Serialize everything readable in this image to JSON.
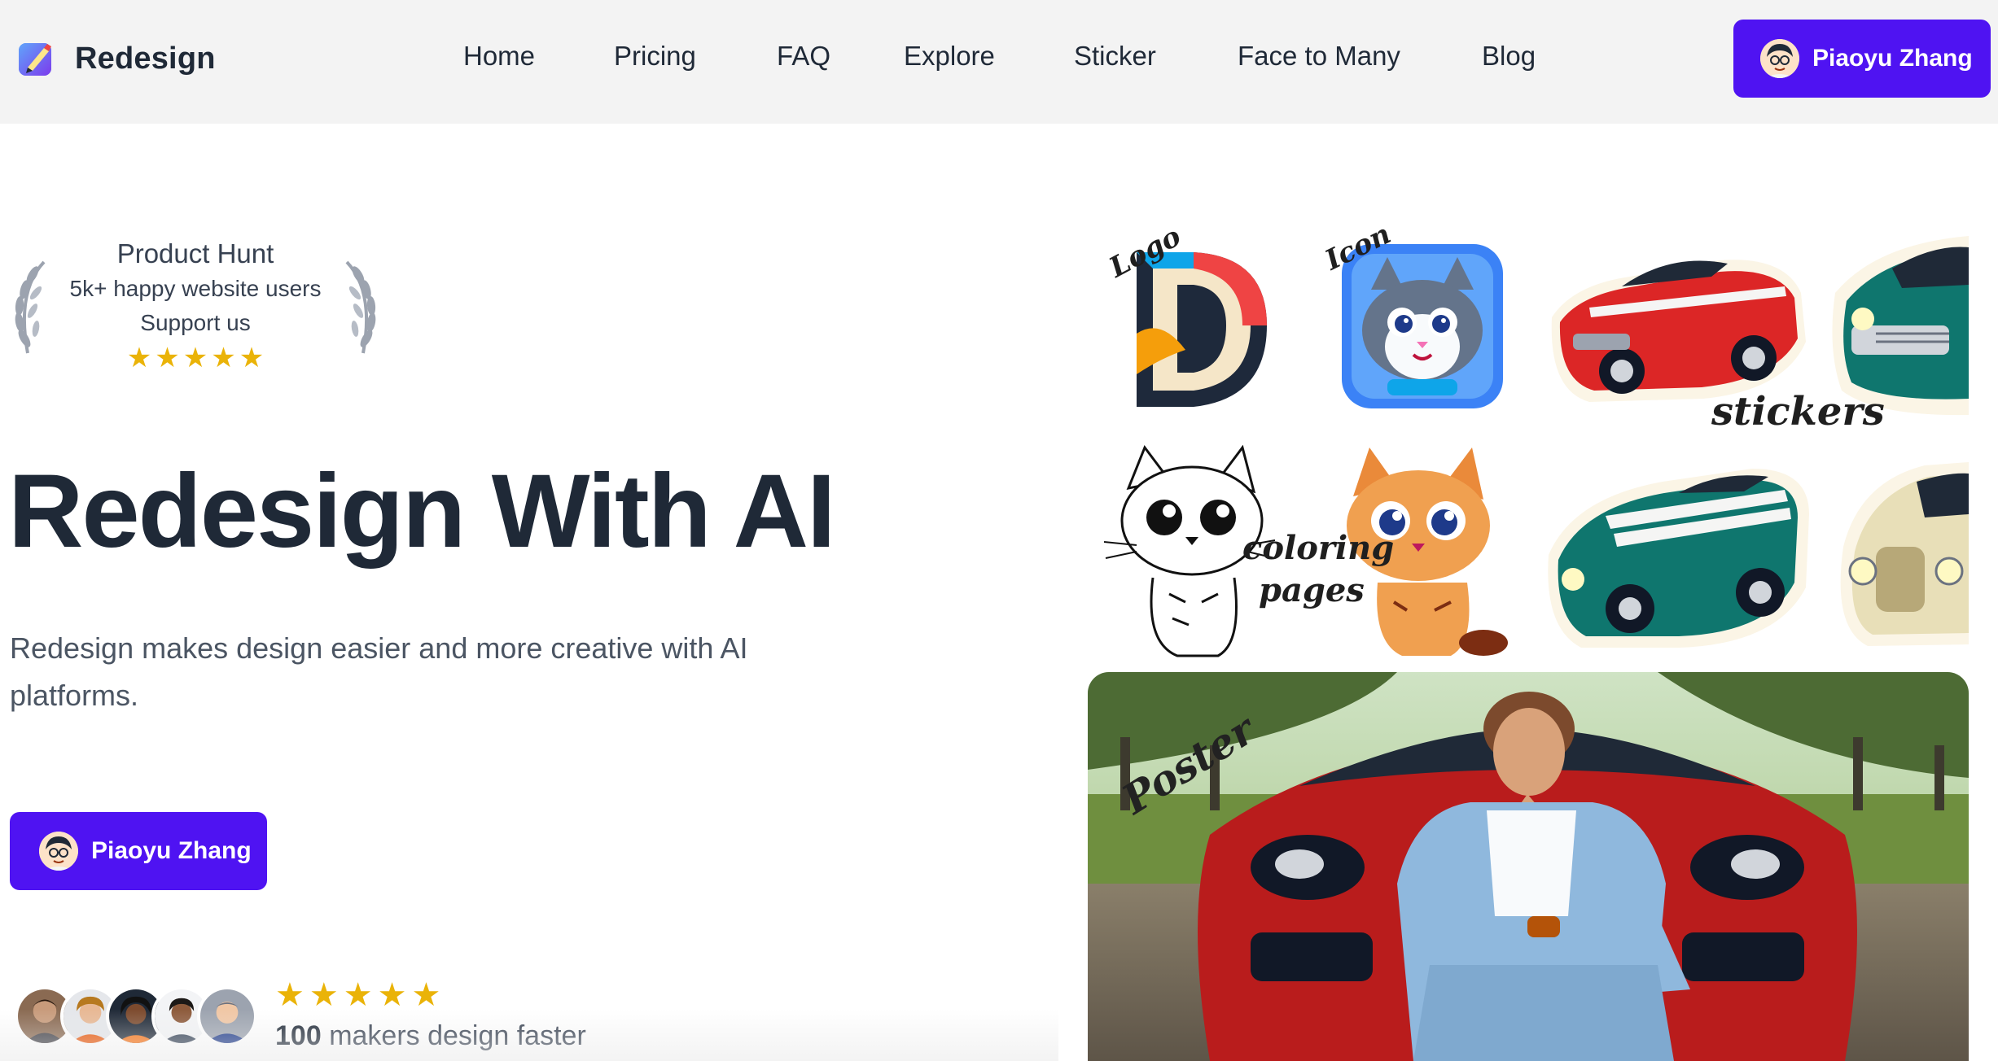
{
  "header": {
    "brand": "Redesign",
    "nav": [
      "Home",
      "Pricing",
      "FAQ",
      "Explore",
      "Sticker",
      "Face to Many",
      "Blog"
    ],
    "user_name": "Piaoyu Zhang"
  },
  "badge": {
    "title": "Product Hunt",
    "line1": "5k+ happy website users",
    "line2": "Support us",
    "stars": 5
  },
  "hero": {
    "title": "Redesign With AI",
    "subtitle": "Redesign makes design easier and more creative with AI platforms.",
    "cta_name": "Piaoyu Zhang"
  },
  "social": {
    "stars": 5,
    "count": "100",
    "text": "makers design faster"
  },
  "gallery": {
    "labels": {
      "logo": "Logo",
      "icon": "Icon",
      "stickers": "stickers",
      "coloring": "coloring",
      "pages": "pages",
      "poster": "Poster"
    }
  },
  "colors": {
    "accent": "#4f13f2",
    "star": "#eab308",
    "header_bg": "#f3f3f3",
    "text_dark": "#1f2937"
  }
}
